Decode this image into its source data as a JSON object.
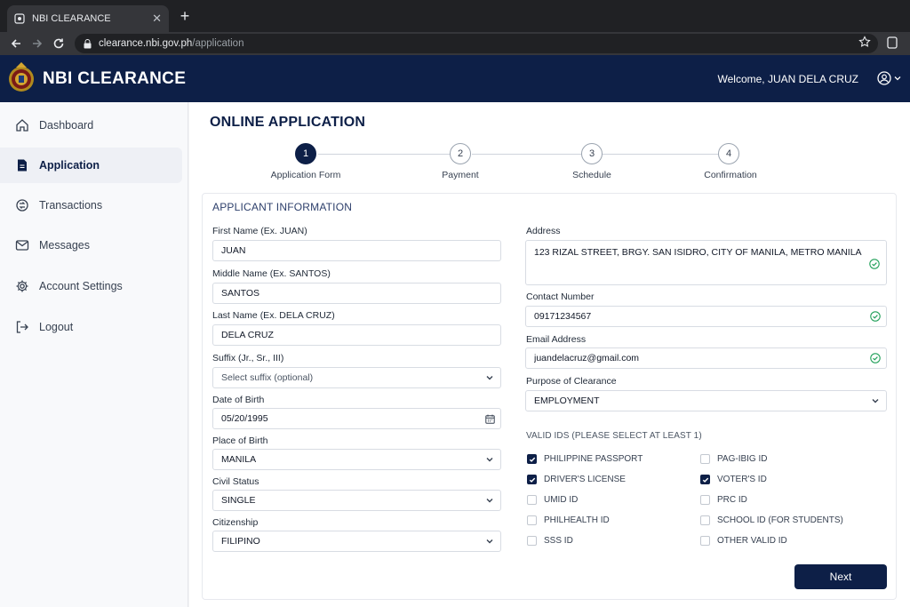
{
  "browser": {
    "tab_title": "NBI CLEARANCE",
    "url_host": "clearance.nbi.gov.ph",
    "url_path": "/application"
  },
  "header": {
    "brand": "NBI CLEARANCE",
    "welcome": "Welcome, JUAN DELA CRUZ"
  },
  "sidebar": {
    "items": [
      {
        "label": "Dashboard",
        "icon": "home-icon"
      },
      {
        "label": "Application",
        "icon": "document-icon"
      },
      {
        "label": "Transactions",
        "icon": "transactions-icon"
      },
      {
        "label": "Messages",
        "icon": "mail-icon"
      },
      {
        "label": "Account Settings",
        "icon": "gear-icon"
      },
      {
        "label": "Logout",
        "icon": "logout-icon"
      }
    ],
    "active_index": 1
  },
  "page": {
    "title": "ONLINE APPLICATION",
    "steps": [
      {
        "num": "1",
        "label": "Application Form"
      },
      {
        "num": "2",
        "label": "Payment"
      },
      {
        "num": "3",
        "label": "Schedule"
      },
      {
        "num": "4",
        "label": "Confirmation"
      }
    ],
    "active_step": 1
  },
  "form": {
    "section_title": "APPLICANT INFORMATION",
    "first_name": {
      "label": "First Name (Ex. JUAN)",
      "value": "JUAN"
    },
    "middle_name": {
      "label": "Middle Name (Ex. SANTOS)",
      "value": "SANTOS"
    },
    "last_name": {
      "label": "Last Name (Ex. DELA CRUZ)",
      "value": "DELA CRUZ"
    },
    "suffix": {
      "label": "Suffix (Jr., Sr., III)",
      "placeholder": "Select suffix (optional)"
    },
    "dob": {
      "label": "Date of Birth",
      "value": "05/20/1995"
    },
    "pob": {
      "label": "Place of Birth",
      "value": "MANILA"
    },
    "civil_status": {
      "label": "Civil Status",
      "value": "SINGLE"
    },
    "citizenship": {
      "label": "Citizenship",
      "value": "FILIPINO"
    },
    "address": {
      "label": "Address",
      "value": "123 RIZAL STREET, BRGY. SAN ISIDRO, CITY OF MANILA, METRO MANILA"
    },
    "contact": {
      "label": "Contact Number",
      "value": "09171234567"
    },
    "email": {
      "label": "Email Address",
      "value": "juandelacruz@gmail.com"
    },
    "purpose": {
      "label": "Purpose of Clearance",
      "value": "EMPLOYMENT"
    },
    "ids_header": "VALID IDS (PLEASE SELECT AT LEAST 1)",
    "ids": [
      {
        "label": "PHILIPPINE PASSPORT",
        "checked": true
      },
      {
        "label": "PAG-IBIG ID",
        "checked": false
      },
      {
        "label": "DRIVER'S LICENSE",
        "checked": true
      },
      {
        "label": "VOTER'S ID",
        "checked": true
      },
      {
        "label": "UMID ID",
        "checked": false
      },
      {
        "label": "PRC ID",
        "checked": false
      },
      {
        "label": "PHILHEALTH ID",
        "checked": false
      },
      {
        "label": "SCHOOL ID (FOR STUDENTS)",
        "checked": false
      },
      {
        "label": "SSS ID",
        "checked": false
      },
      {
        "label": "OTHER VALID ID",
        "checked": false
      }
    ],
    "next_label": "Next"
  },
  "colors": {
    "navy": "#0d1f47",
    "valid_green": "#22a05a"
  }
}
